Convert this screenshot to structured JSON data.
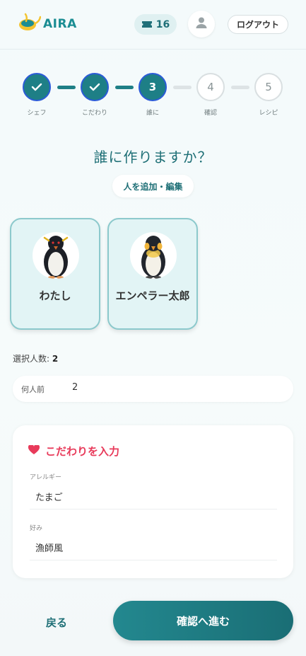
{
  "header": {
    "logo_text": "AIRA",
    "credits": "16",
    "logout_label": "ログアウト",
    "icons": {
      "logo": "cooking-pot-icon",
      "credits": "ticket-icon",
      "avatar": "user-icon"
    }
  },
  "steps": [
    {
      "label": "シェフ",
      "status": "done"
    },
    {
      "label": "こだわり",
      "status": "done"
    },
    {
      "number": "3",
      "label": "誰に",
      "status": "current"
    },
    {
      "number": "4",
      "label": "確認",
      "status": "todo"
    },
    {
      "number": "5",
      "label": "レシピ",
      "status": "todo"
    }
  ],
  "question": "誰に作りますか？",
  "add_edit_label": "人を追加・編集",
  "people": [
    {
      "name": "わたし",
      "avatar": "rockhopper-penguin"
    },
    {
      "name": "エンペラー太郎",
      "avatar": "emperor-penguin"
    }
  ],
  "selection": {
    "label": "選択人数:",
    "count": "2"
  },
  "servings": {
    "label": "何人前",
    "value": "2"
  },
  "preferences": {
    "title": "こだわりを入力",
    "fields": [
      {
        "label": "アレルギー",
        "value": "たまご"
      },
      {
        "label": "好み",
        "value": "漁師風"
      }
    ]
  },
  "nav": {
    "back_label": "戻る",
    "next_label": "確認へ進む"
  },
  "colors": {
    "accent": "#1e7f86",
    "heart": "#e83a5a",
    "step_border": "#2b5bd7"
  }
}
